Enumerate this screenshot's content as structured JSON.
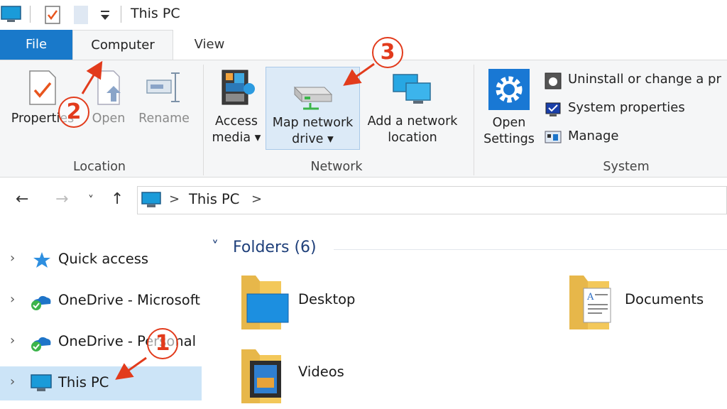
{
  "window": {
    "title": "This PC"
  },
  "tabs": [
    {
      "label": "File"
    },
    {
      "label": "Computer"
    },
    {
      "label": "View"
    }
  ],
  "ribbon": {
    "location": {
      "group_label": "Location",
      "properties": "Properties",
      "open": "Open",
      "rename": "Rename"
    },
    "network": {
      "group_label": "Network",
      "access_media_1": "Access",
      "access_media_2": "media",
      "map_drive_1": "Map network",
      "map_drive_2": "drive",
      "add_location_1": "Add a network",
      "add_location_2": "location"
    },
    "system": {
      "group_label": "System",
      "open_settings_1": "Open",
      "open_settings_2": "Settings",
      "uninstall": "Uninstall or change a pr",
      "system_properties": "System properties",
      "manage": "Manage"
    }
  },
  "address": {
    "path": "This PC",
    "sep1": ">",
    "sep2": ">"
  },
  "nav": {
    "items": [
      {
        "label": "Quick access"
      },
      {
        "label": "OneDrive - Microsoft"
      },
      {
        "label": "OneDrive - Personal"
      },
      {
        "label": "This PC"
      }
    ]
  },
  "content": {
    "folders_header": "Folders (6)",
    "folders": [
      {
        "name": "Desktop"
      },
      {
        "name": "Documents"
      },
      {
        "name": "Videos"
      }
    ]
  },
  "annotations": [
    {
      "number": "1"
    },
    {
      "number": "2"
    },
    {
      "number": "3"
    }
  ],
  "colors": {
    "file_tab": "#1979ca",
    "annotation": "#e23b1c",
    "selection": "#cce4f7",
    "folder": "#f3c85a"
  }
}
